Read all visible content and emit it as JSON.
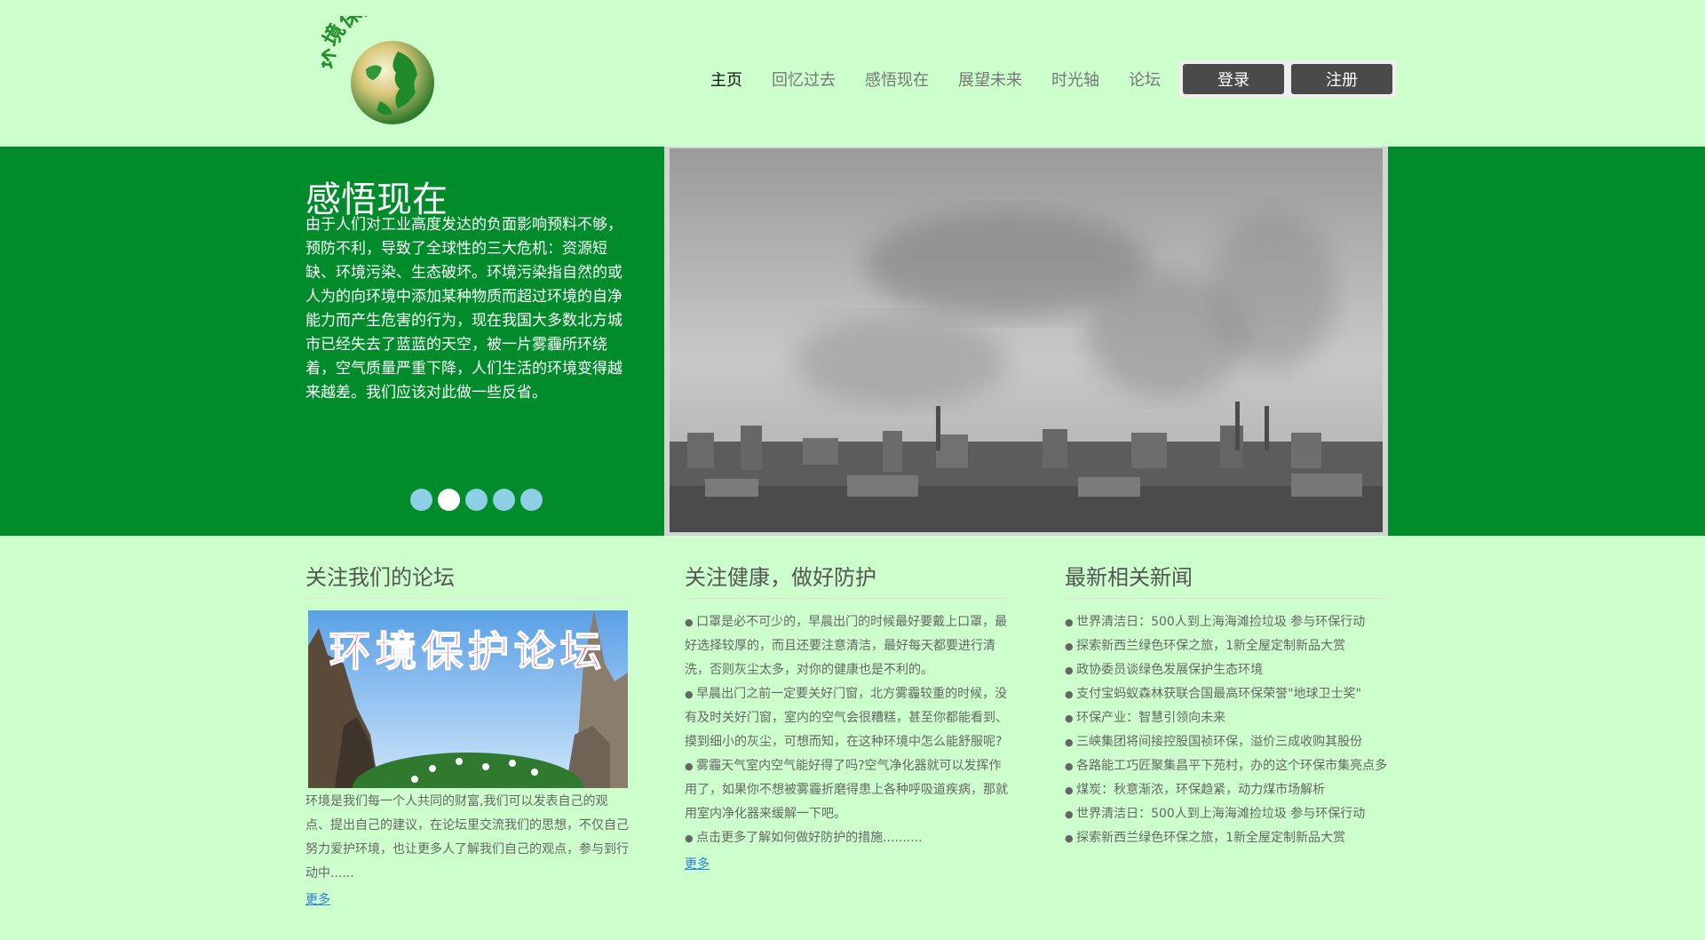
{
  "header": {
    "logo_text": "环境保护网",
    "nav": [
      "主页",
      "回忆过去",
      "感悟现在",
      "展望未来",
      "时光轴",
      "论坛"
    ],
    "login_label": "登录",
    "register_label": "注册"
  },
  "banner": {
    "title": "感悟现在",
    "text": "由于人们对工业高度发达的负面影响预料不够，预防不利，导致了全球性的三大危机：资源短缺、环境污染、生态破坏。环境污染指自然的或人为的向环境中添加某种物质而超过环境的自净能力而产生危害的行为，现在我国大多数北方城市已经失去了蓝蓝的天空，被一片雾霾所环绕着，空气质量严重下降，人们生活的环境变得越来越差。我们应该对此做一些反省。",
    "slide_count": 5,
    "active_slide": 2
  },
  "forum": {
    "title": "关注我们的论坛",
    "image_text": "环境保护论坛",
    "text": "环境是我们每一个人共同的财富,我们可以发表自己的观点、提出自己的建议，在论坛里交流我们的思想，不仅自己努力爱护环境，也让更多人了解我们自己的观点，参与到行动中......",
    "more": "更多"
  },
  "health": {
    "title": "关注健康，做好防护",
    "items": [
      "口罩是必不可少的，早晨出门的时候最好要戴上口罩，最好选择较厚的，而且还要注意清洁，最好每天都要进行清洗，否则灰尘太多，对你的健康也是不利的。",
      "早晨出门之前一定要关好门窗，北方雾霾较重的时候，没有及时关好门窗，室内的空气会很糟糕，甚至你都能看到、摸到细小的灰尘，可想而知，在这种环境中怎么能舒服呢?",
      "雾霾天气室内空气能好得了吗?空气净化器就可以发挥作用了，如果你不想被雾霾折磨得患上各种呼吸道疾病，那就用室内净化器来缓解一下吧。",
      "点击更多了解如何做好防护的措施.........."
    ],
    "more": "更多"
  },
  "news": {
    "title": "最新相关新闻",
    "items": [
      "世界清洁日：500人到上海海滩捡垃圾 参与环保行动",
      "探索新西兰绿色环保之旅，1新全屋定制新品大赏",
      "政协委员谈绿色发展保护生态环境",
      "支付宝蚂蚁森林获联合国最高环保荣誉\"地球卫士奖\"",
      "环保产业：智慧引领向未来",
      "三峡集团将间接控股国祯环保，溢价三成收购其股份",
      "各路能工巧匠聚集昌平下苑村，办的这个环保市集亮点多",
      "煤炭：秋意渐浓，环保趋紧，动力煤市场解析",
      "世界清洁日：500人到上海海滩捡垃圾 参与环保行动",
      "探索新西兰绿色环保之旅，1新全屋定制新品大赏"
    ]
  }
}
